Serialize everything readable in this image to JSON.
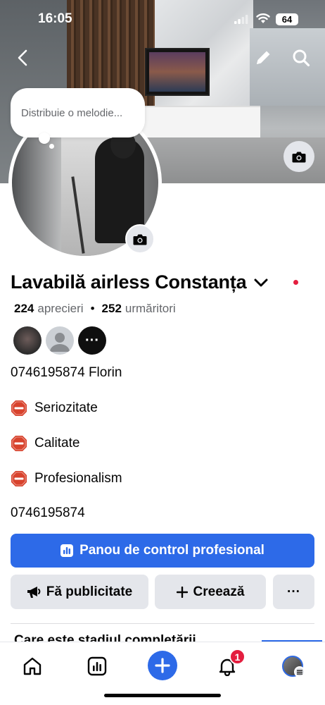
{
  "status_bar": {
    "time": "16:05",
    "battery": "64"
  },
  "cover": {
    "has_camera_button": true
  },
  "note": {
    "placeholder": "Distribuie o melodie..."
  },
  "profile": {
    "name": "Lavabilă airless Constanța",
    "likes_count": "224",
    "likes_label": "aprecieri",
    "followers_count": "252",
    "followers_label": "urmăritori",
    "separator": "•"
  },
  "friends": {
    "more_label": "···"
  },
  "bio": [
    {
      "text": "0746195874 Florin",
      "icon": null
    },
    {
      "text": "Seriozitate",
      "icon": "stop-sign-icon"
    },
    {
      "text": "Calitate",
      "icon": "stop-sign-icon"
    },
    {
      "text": "Profesionalism",
      "icon": "stop-sign-icon"
    },
    {
      "text": "0746195874",
      "icon": null
    }
  ],
  "actions": {
    "dashboard_label": "Panou de control profesional",
    "advertise_label": "Fă publicitate",
    "create_label": "Creează",
    "more_label": "···"
  },
  "section_peek": {
    "text": "Care este stadiul completării"
  },
  "bottom_nav": {
    "items": [
      "home-icon",
      "dashboard-icon",
      "create-icon",
      "notifications-icon",
      "profile-icon"
    ],
    "notification_badge": "1"
  },
  "colors": {
    "accent": "#2d6ae8",
    "badge": "#e41e3f",
    "secondary_button": "#e4e6eb"
  }
}
